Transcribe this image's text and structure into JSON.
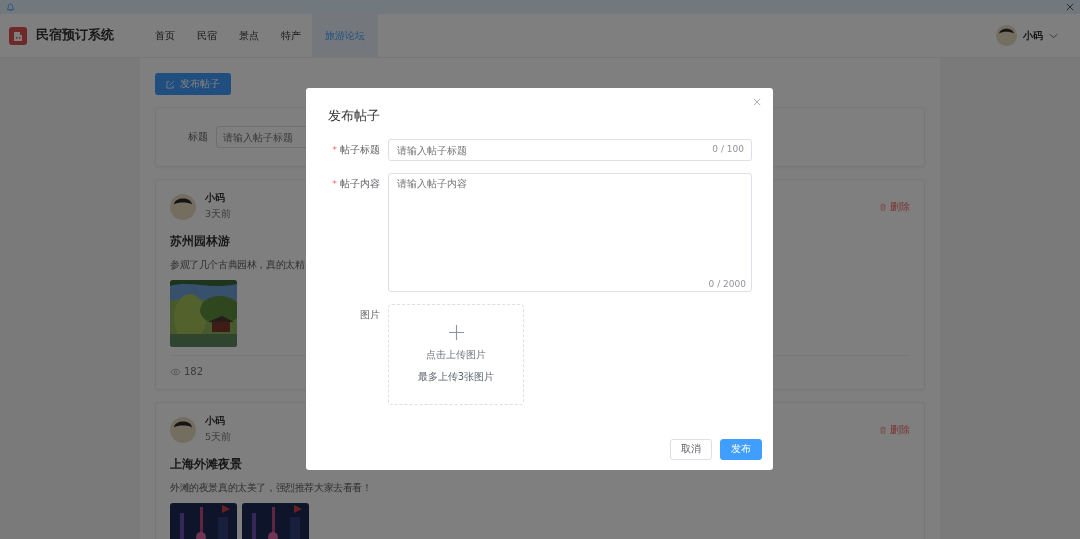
{
  "app_title": "民宿预订系统",
  "nav": [
    {
      "label": "首页",
      "selected": false
    },
    {
      "label": "民宿",
      "selected": false
    },
    {
      "label": "景点",
      "selected": false
    },
    {
      "label": "特产",
      "selected": false
    },
    {
      "label": "旅游论坛",
      "selected": true
    }
  ],
  "user": {
    "name": "小码"
  },
  "publish_button": "发布帖子",
  "search": {
    "label": "标题",
    "placeholder": "请输入帖子标题"
  },
  "posts": [
    {
      "author": "小码",
      "time": "3天前",
      "title": "苏州园林游",
      "body": "参观了几个古典园林，真的太精",
      "delete": "删除",
      "views": "182"
    },
    {
      "author": "小码",
      "time": "5天前",
      "title": "上海外滩夜景",
      "body": "外滩的夜景真的太美了，强烈推荐大家去看看！",
      "delete": "删除"
    }
  ],
  "dialog": {
    "title": "发布帖子",
    "fields": [
      {
        "kind": "input",
        "label": "帖子标题",
        "mark": "*",
        "placeholder": "请输入帖子标题",
        "counter": "0 / 100"
      },
      {
        "kind": "textarea",
        "label": "帖子内容",
        "mark": "*",
        "placeholder": "请输入帖子内容",
        "counter": "0 / 2000"
      },
      {
        "kind": "upload",
        "label": "图片",
        "text": "点击上传图片",
        "hint": "最多上传3张图片"
      }
    ],
    "buttons": [
      {
        "label": "取消",
        "primary": false
      },
      {
        "label": "发布",
        "primary": true
      }
    ]
  }
}
